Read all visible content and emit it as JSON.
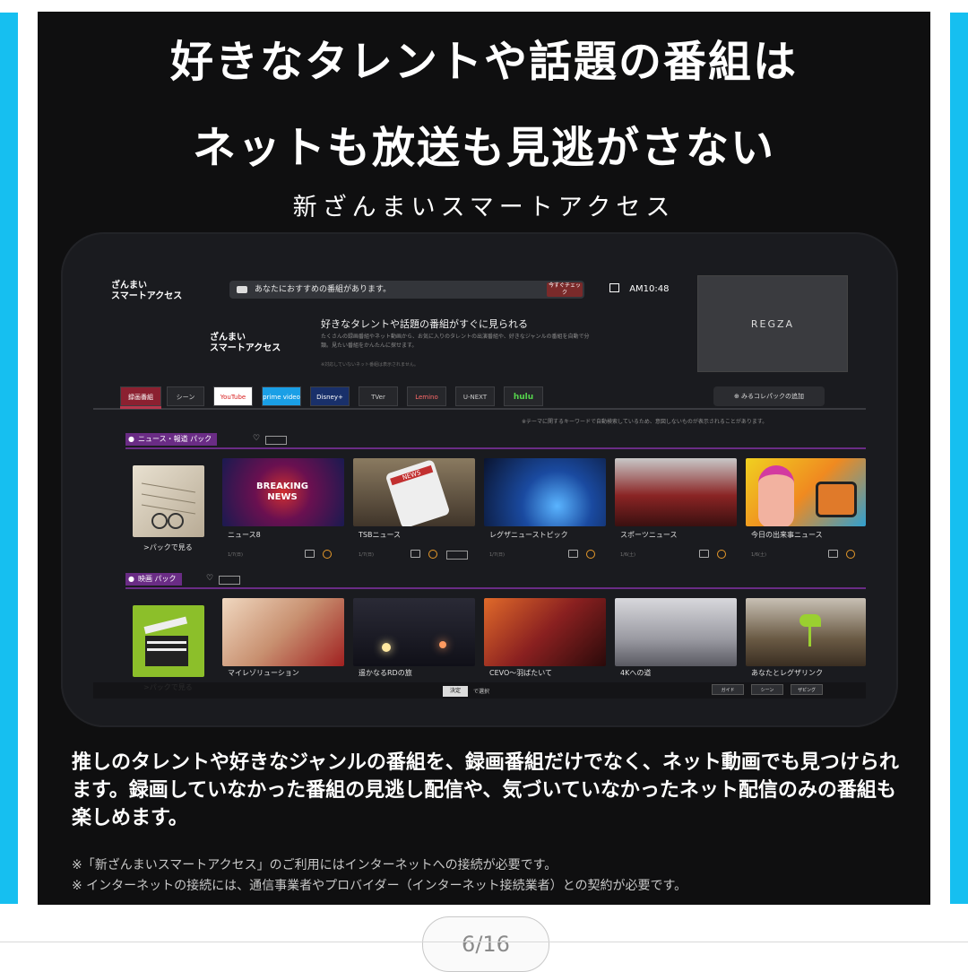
{
  "slide": {
    "headline_line1": "好きなタレントや話題の番組は",
    "headline_line2": "ネットも放送も見逃がさない",
    "subheadline": "新ざんまいスマートアクセス",
    "body_copy": "推しのタレントや好きなジャンルの番組を、録画番組だけでなく、ネット動画でも見つけられます。録画していなかった番組の見逃し配信や、気づいていなかったネット配信のみの番組も楽しめます。",
    "note_line1": "※「新ざんまいスマートアクセス」のご利用にはインターネットへの接続が必要です。",
    "note_line2": "※ インターネットの接続には、通信事業者やプロバイダー（インターネット接続業者）との契約が必要です。"
  },
  "tv": {
    "brand_line1": "ざんまい",
    "brand_line2": "スマートアクセス",
    "notification": "あなたにおすすめの番組があります。",
    "notification_button": "今すぐチェック",
    "clock": "AM10:48",
    "preview_label": "REGZA",
    "hero_title": "好きなタレントや話題の番組がすぐに見られる",
    "hero_text": "たくさんの録画番組やネット動画から、お気に入りのタレントの出演番組や、好きなジャンルの番組を自動で分類。見たい番組をかんたんに探せます。",
    "hero_note": "※対応していないネット番組は表示されません。",
    "tabs": [
      "録画番組",
      "シーン",
      "YouTube",
      "prime video",
      "Disney+",
      "TVer",
      "Lemino",
      "U-NEXT",
      "hulu"
    ],
    "add_pack": "みるコレパックの追加",
    "disclaimer": "※テーマに関するキーワードで自動検索しているため、意図しないものが表示されることがあります。",
    "pack_news": "ニュース・報道 パック",
    "pack_movie": "映画 パック",
    "see_pack": ">パックで見る",
    "news_items": [
      {
        "title": "ニュース8",
        "date": "1/7(日)"
      },
      {
        "title": "TSBニュース",
        "date": "1/7(日)"
      },
      {
        "title": "レグザニューストピック",
        "date": "1/7(日)"
      },
      {
        "title": "スポーツニュース",
        "date": "1/6(土)"
      },
      {
        "title": "今日の出来事ニュース",
        "date": "1/6(土)"
      }
    ],
    "movie_items": [
      {
        "title": "マイレゾリューション"
      },
      {
        "title": "遥かなるRDの旅"
      },
      {
        "title": "CEVO〜羽ばたいて"
      },
      {
        "title": "4Kへの道"
      },
      {
        "title": "あなたとレグザリンク"
      }
    ],
    "breaking_news_line1": "BREAKING",
    "breaking_news_line2": "NEWS",
    "news_paper": "NEWS",
    "decide_label": "決定",
    "select_label": "で選択",
    "footer_buttons": [
      "ガイド",
      "シーン",
      "ザピング"
    ]
  },
  "pager": {
    "label": "6/16"
  },
  "colors": {
    "accent_cyan": "#16bff0",
    "pack_purple": "#6a2c85",
    "tab_active": "#8b2030"
  }
}
